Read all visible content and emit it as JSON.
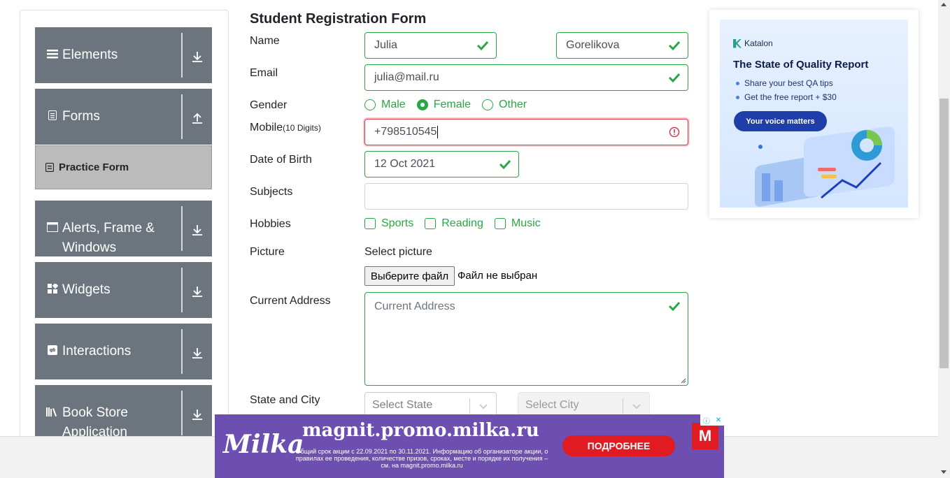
{
  "sidebar": {
    "groups": [
      {
        "label": "Elements",
        "icon": "hamburger-icon",
        "arrow": "down-arrow-icon"
      },
      {
        "label": "Forms",
        "icon": "form-icon",
        "arrow": "up-arrow-icon"
      },
      {
        "label": "Alerts, Frame & Windows",
        "icon": "window-icon",
        "arrow": "down-arrow-icon"
      },
      {
        "label": "Widgets",
        "icon": "widgets-icon",
        "arrow": "down-arrow-icon"
      },
      {
        "label": "Interactions",
        "icon": "interactions-icon",
        "arrow": "down-arrow-icon"
      },
      {
        "label": "Book Store Application",
        "icon": "books-icon",
        "arrow": "down-arrow-icon"
      }
    ],
    "active_item": "Practice Form"
  },
  "form": {
    "title": "Student Registration Form",
    "name_label": "Name",
    "first_name": "Julia",
    "last_name": "Gorelikova",
    "email_label": "Email",
    "email": "julia@mail.ru",
    "gender_label": "Gender",
    "gender_options": [
      "Male",
      "Female",
      "Other"
    ],
    "gender_selected": "Female",
    "mobile_label": "Mobile",
    "mobile_hint": "(10 Digits)",
    "mobile": "+798510545",
    "dob_label": "Date of Birth",
    "dob": "12 Oct 2021",
    "subjects_label": "Subjects",
    "hobbies_label": "Hobbies",
    "hobbies": [
      "Sports",
      "Reading",
      "Music"
    ],
    "picture_label": "Picture",
    "select_picture": "Select picture",
    "file_button": "Выберите файл",
    "file_status": "Файл не выбран",
    "address_label": "Current Address",
    "address_placeholder": "Current Address",
    "state_city_label": "State and City",
    "state_placeholder": "Select State",
    "city_placeholder": "Select City"
  },
  "ad_right": {
    "brand": "Katalon",
    "title": "The State of Quality Report",
    "bullets": [
      "Share your best QA tips",
      "Get the free report + $30"
    ],
    "cta": "Your voice matters"
  },
  "ad_bottom": {
    "brand": "Milka",
    "url": "magnit.promo.milka.ru",
    "text": "Общий срок акции с 22.09.2021 по 30.11.2021. Информацию об организаторе акции, о правилах ее проведения, количестве призов, сроках, месте и порядке их получения – см. на magnit.promo.milka.ru",
    "cta": "ПОДРОБНЕЕ",
    "logo_text": "М"
  },
  "colors": {
    "valid": "#28a745",
    "invalid": "#dc3545",
    "sidebar": "#6c757d"
  }
}
